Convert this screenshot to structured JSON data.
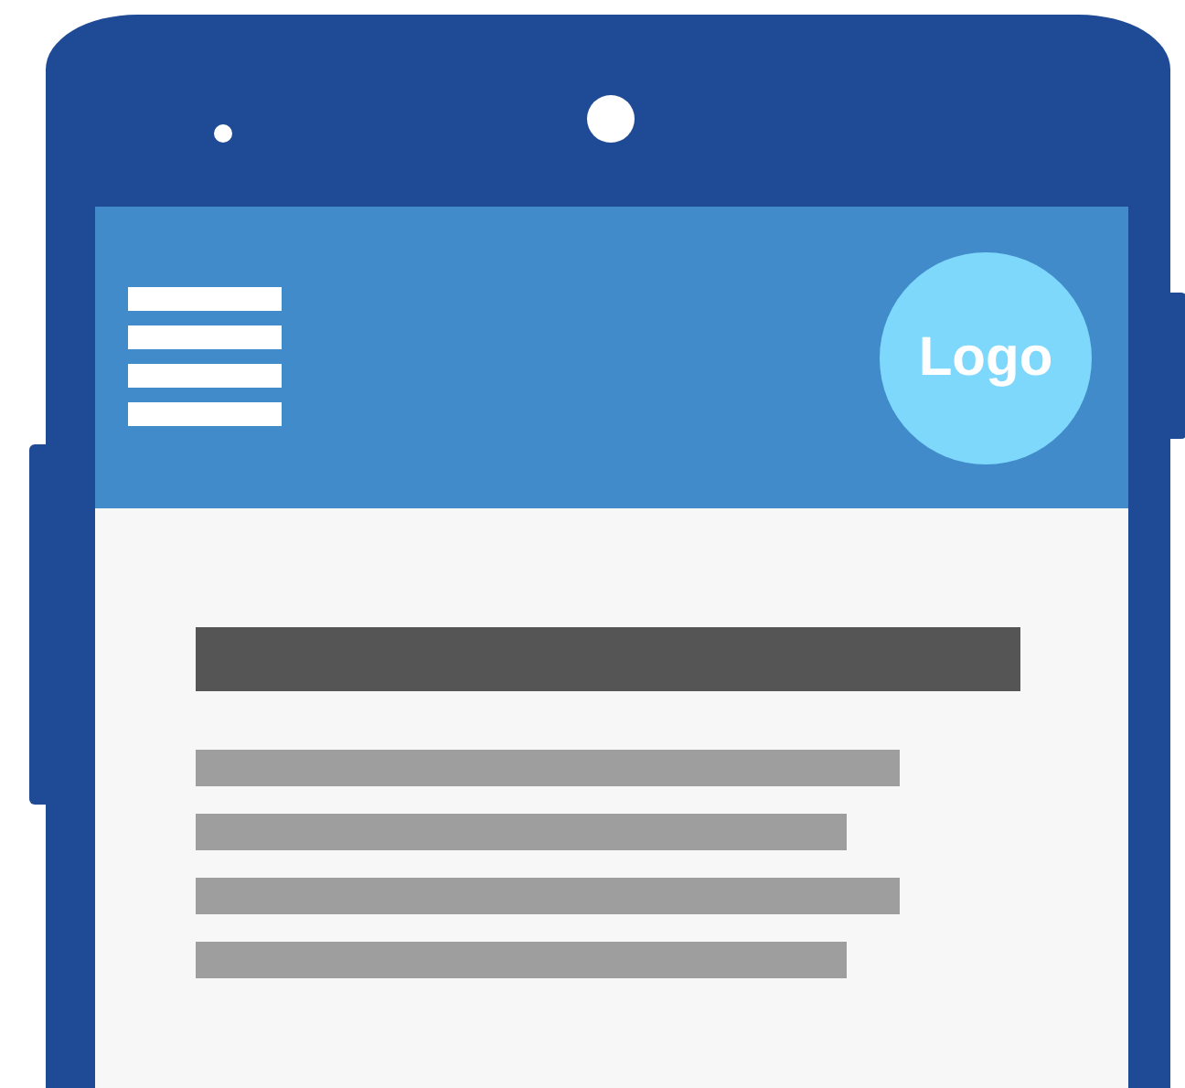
{
  "app_bar": {
    "logo": "Logo"
  }
}
